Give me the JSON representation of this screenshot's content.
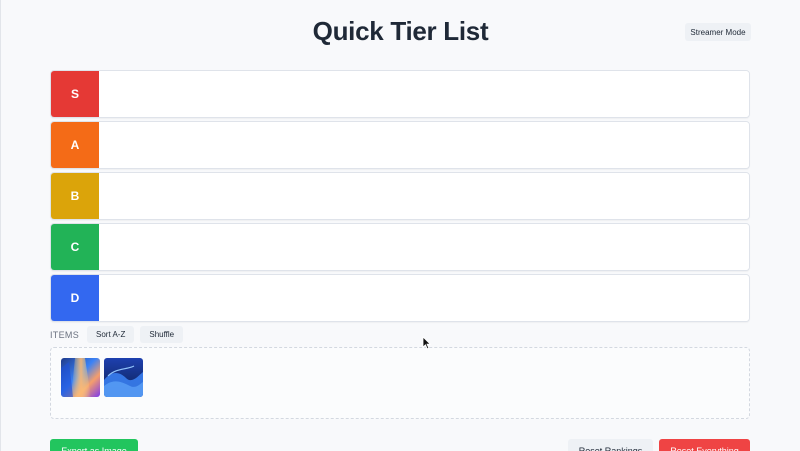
{
  "header": {
    "title": "Quick Tier List",
    "streamer_label": "Streamer Mode"
  },
  "tiers": [
    {
      "label": "S",
      "color": "#e53935"
    },
    {
      "label": "A",
      "color": "#f46b17"
    },
    {
      "label": "B",
      "color": "#dba40a"
    },
    {
      "label": "C",
      "color": "#22b357"
    },
    {
      "label": "D",
      "color": "#3368f0"
    }
  ],
  "items": {
    "title": "ITEMS",
    "sort_label": "Sort A-Z",
    "shuffle_label": "Shuffle",
    "pool": [
      {
        "icon": "abstract-light-rays-image"
      },
      {
        "icon": "blue-wave-image"
      }
    ]
  },
  "footer": {
    "export_label": "Export as Image",
    "reset_rankings_label": "Reset Rankings",
    "reset_everything_label": "Reset Everything"
  }
}
